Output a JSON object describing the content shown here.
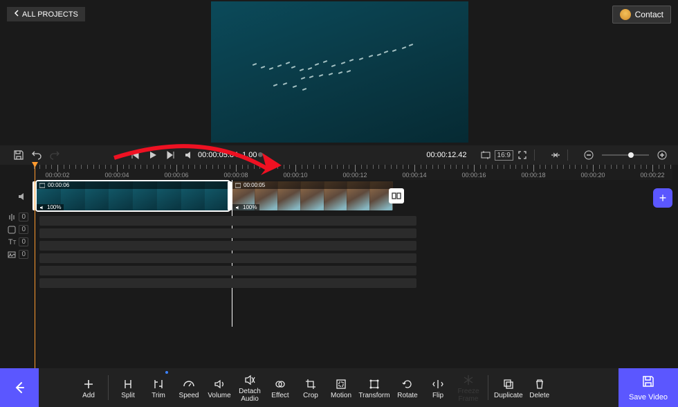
{
  "header": {
    "back_label": "ALL PROJECTS",
    "contact_label": "Contact"
  },
  "player": {
    "current_time": "00:00:05.84",
    "playback_rate": "1.00",
    "total_time": "00:00:12.42",
    "aspect_ratio": "16:9"
  },
  "ruler": {
    "labels": [
      "00:00:02",
      "00:00:04",
      "00:00:06",
      "00:00:08",
      "00:00:10",
      "00:00:12",
      "00:00:14",
      "00:00:16",
      "00:00:18",
      "00:00:20",
      "00:00:22"
    ]
  },
  "tracks": {
    "audio_count": "0",
    "sticker_count": "0",
    "text_count": "0",
    "image_count": "0"
  },
  "clips": {
    "clip1": {
      "duration": "00:00:06",
      "volume": "100%"
    },
    "clip2": {
      "duration": "00:00:05",
      "volume": "100%"
    }
  },
  "toolbar": {
    "add": "Add",
    "split": "Split",
    "trim": "Trim",
    "speed": "Speed",
    "volume": "Volume",
    "detach_audio1": "Detach",
    "detach_audio2": "Audio",
    "effect": "Effect",
    "crop": "Crop",
    "motion": "Motion",
    "transform": "Transform",
    "rotate": "Rotate",
    "flip": "Flip",
    "freeze1": "Freeze",
    "freeze2": "Frame",
    "duplicate": "Duplicate",
    "delete": "Delete",
    "save": "Save Video"
  }
}
